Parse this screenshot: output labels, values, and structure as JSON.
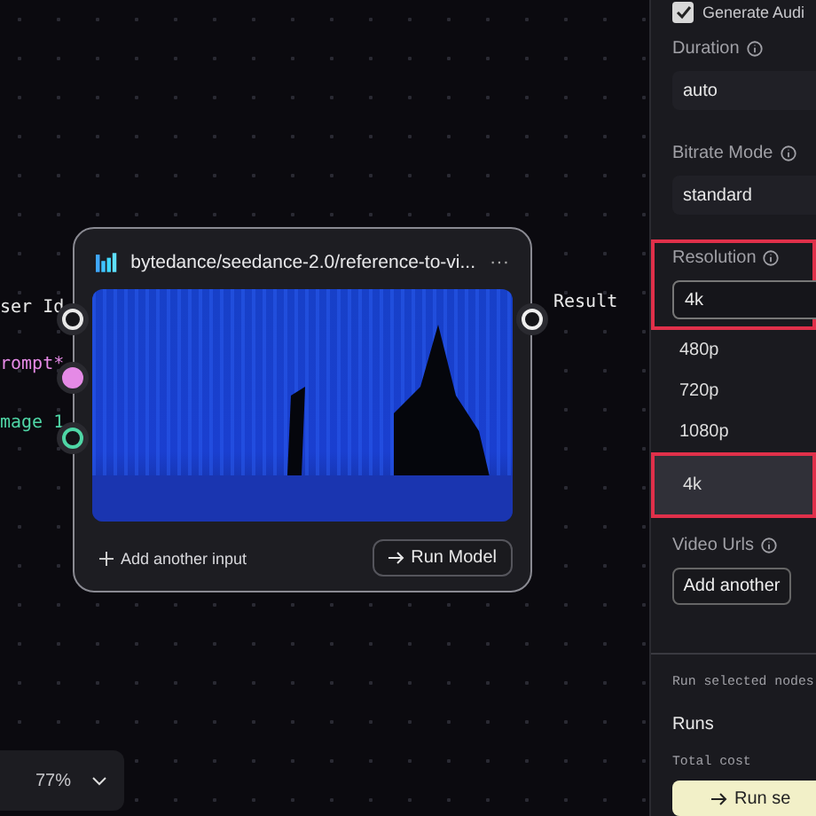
{
  "canvas": {
    "input_ports": [
      {
        "label": "ser Id",
        "kind": "plain"
      },
      {
        "label": "rompt*",
        "kind": "prompt"
      },
      {
        "label": "mage 1",
        "kind": "image"
      }
    ],
    "output_port": {
      "label": "Result"
    },
    "node": {
      "title": "bytedance/seedance-2.0/reference-to-vi...",
      "menu": "···",
      "add_input": "Add another input",
      "run_button": "Run Model"
    },
    "zoom": {
      "value": "77%"
    }
  },
  "panel": {
    "generate_audio": {
      "label": "Generate Audi",
      "checked": true
    },
    "fields": [
      {
        "label": "Duration",
        "value": "auto",
        "highlighted": false
      },
      {
        "label": "Bitrate Mode",
        "value": "standard",
        "highlighted": false
      },
      {
        "label": "Resolution",
        "value": "4k",
        "highlighted": true
      }
    ],
    "resolution_options": [
      {
        "label": "480p",
        "selected": false,
        "highlighted": false
      },
      {
        "label": "720p",
        "selected": false,
        "highlighted": false
      },
      {
        "label": "1080p",
        "selected": false,
        "highlighted": false
      },
      {
        "label": "4k",
        "selected": true,
        "highlighted": true
      }
    ],
    "video_urls": {
      "label": "Video Urls",
      "button": "Add another"
    },
    "run_section": {
      "heading": "Run selected nodes",
      "runs_label": "Runs",
      "cost_label": "Total cost",
      "run_button": "Run se"
    }
  }
}
